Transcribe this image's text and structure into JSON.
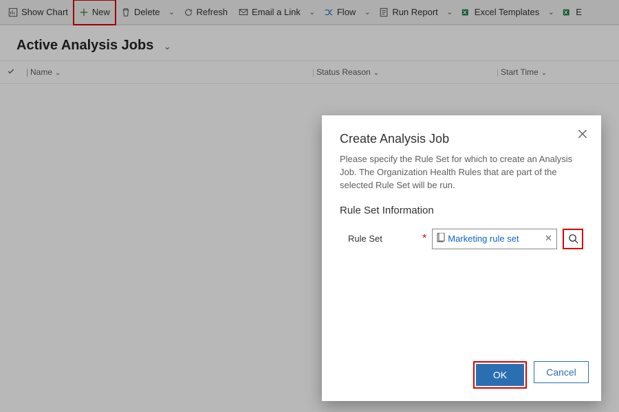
{
  "toolbar": {
    "show_chart": "Show Chart",
    "new": "New",
    "delete": "Delete",
    "refresh": "Refresh",
    "email_link": "Email a Link",
    "flow": "Flow",
    "run_report": "Run Report",
    "excel_templates": "Excel Templates",
    "excel_cutoff": "E"
  },
  "view": {
    "title": "Active Analysis Jobs",
    "columns": {
      "name": "Name",
      "status_reason": "Status Reason",
      "start_time": "Start Time"
    }
  },
  "dialog": {
    "title": "Create Analysis Job",
    "description": "Please specify the Rule Set for which to create an Analysis Job. The Organization Health Rules that are part of the selected Rule Set will be run.",
    "section_title": "Rule Set Information",
    "field_label": "Rule Set",
    "selected_value": "Marketing rule set",
    "ok_label": "OK",
    "cancel_label": "Cancel"
  }
}
